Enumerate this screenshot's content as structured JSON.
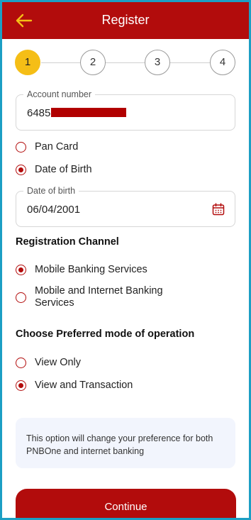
{
  "header": {
    "title": "Register",
    "back_icon": "back-arrow-icon",
    "background": "#b20c0c",
    "icon_color": "#f5be16"
  },
  "stepper": {
    "steps": [
      "1",
      "2",
      "3",
      "4"
    ],
    "active_step": 1
  },
  "account": {
    "label": "Account number",
    "value_prefix": "6485"
  },
  "identification": {
    "options": [
      {
        "label": "Pan Card",
        "checked": false
      },
      {
        "label": "Date of Birth",
        "checked": true
      }
    ]
  },
  "dob": {
    "label": "Date of birth",
    "value": "06/04/2001",
    "icon": "calendar-icon"
  },
  "registration_channel": {
    "title": "Registration Channel",
    "options": [
      {
        "label": "Mobile Banking Services",
        "checked": true
      },
      {
        "label_line1": "Mobile and Internet Banking",
        "label_line2": "Services",
        "checked": false
      }
    ]
  },
  "mode": {
    "title": "Choose Preferred mode of operation",
    "options": [
      {
        "label": "View Only",
        "checked": false
      },
      {
        "label": "View and Transaction",
        "checked": true
      }
    ]
  },
  "info": {
    "line1": "This option will change your preference for both",
    "line2": "PNBOne and internet banking"
  },
  "continue_label": "Continue"
}
